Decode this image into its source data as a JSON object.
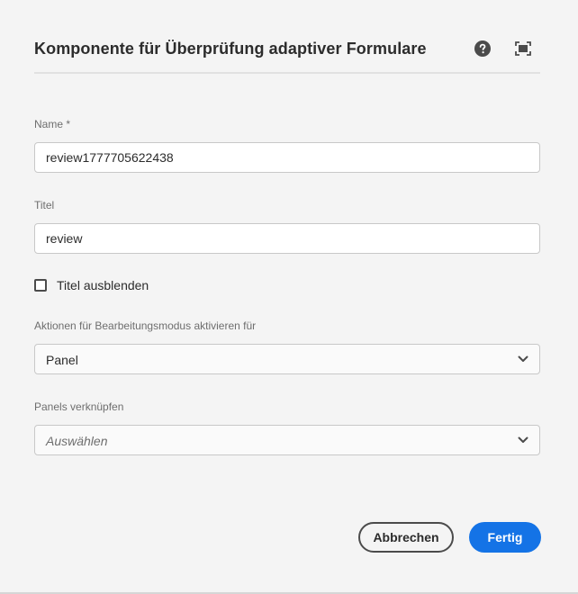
{
  "dialog": {
    "title": "Komponente für Überprüfung adaptiver Formulare",
    "help_icon": "help-circle-icon",
    "fullscreen_icon": "fullscreen-icon"
  },
  "fields": {
    "name": {
      "label": "Name *",
      "value": "review1777705622438"
    },
    "titel": {
      "label": "Titel",
      "value": "review"
    },
    "hide_title": {
      "label": "Titel ausblenden",
      "checked": false
    },
    "edit_mode_actions": {
      "label": "Aktionen für Bearbeitungsmodus aktivieren für",
      "value": "Panel"
    },
    "link_panels": {
      "label": "Panels verknüpfen",
      "placeholder": "Auswählen"
    }
  },
  "buttons": {
    "cancel": "Abbrechen",
    "done": "Fertig"
  },
  "colors": {
    "accent": "#1473e6",
    "background": "#f4f4f4"
  }
}
